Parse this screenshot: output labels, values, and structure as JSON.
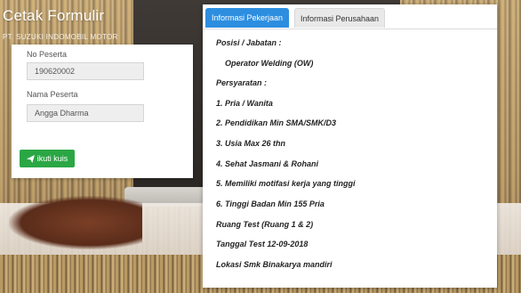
{
  "brand": {
    "title": "Cetak Formulir",
    "subtitle": "PT. SUZUKI INDOMOBIL MOTOR"
  },
  "form": {
    "no_peserta_label": "No Peserta",
    "no_peserta_value": "190620002",
    "nama_peserta_label": "Nama Peserta",
    "nama_peserta_value": "Angga Dharma",
    "submit_label": "ikuti kuis"
  },
  "tabs": [
    {
      "label": "Informasi Pekerjaan",
      "active": true
    },
    {
      "label": "Informasi Perusahaan",
      "active": false
    }
  ],
  "job": {
    "position_heading": "Posisi / Jabatan :",
    "position_value": "Operator Welding (OW)",
    "requirements_heading": "Persyaratan :",
    "requirements": [
      "1. Pria / Wanita",
      "2. Pendidikan Min SMA/SMK/D3",
      "3. Usia Max 26 thn",
      "4. Sehat Jasmani & Rohani",
      "5. Memiliki motifasi kerja yang tinggi",
      "6. Tinggi Badan Min 155 Pria"
    ],
    "test_room": "Ruang Test (Ruang 1 & 2)",
    "test_date": "Tanggal Test 12-09-2018",
    "location": "Lokasi Smk Binakarya mandiri"
  },
  "colors": {
    "tab_active_bg": "#2d8ee0",
    "button_bg": "#2aa744"
  },
  "icons": {
    "submit_icon": "paper-plane-icon"
  }
}
